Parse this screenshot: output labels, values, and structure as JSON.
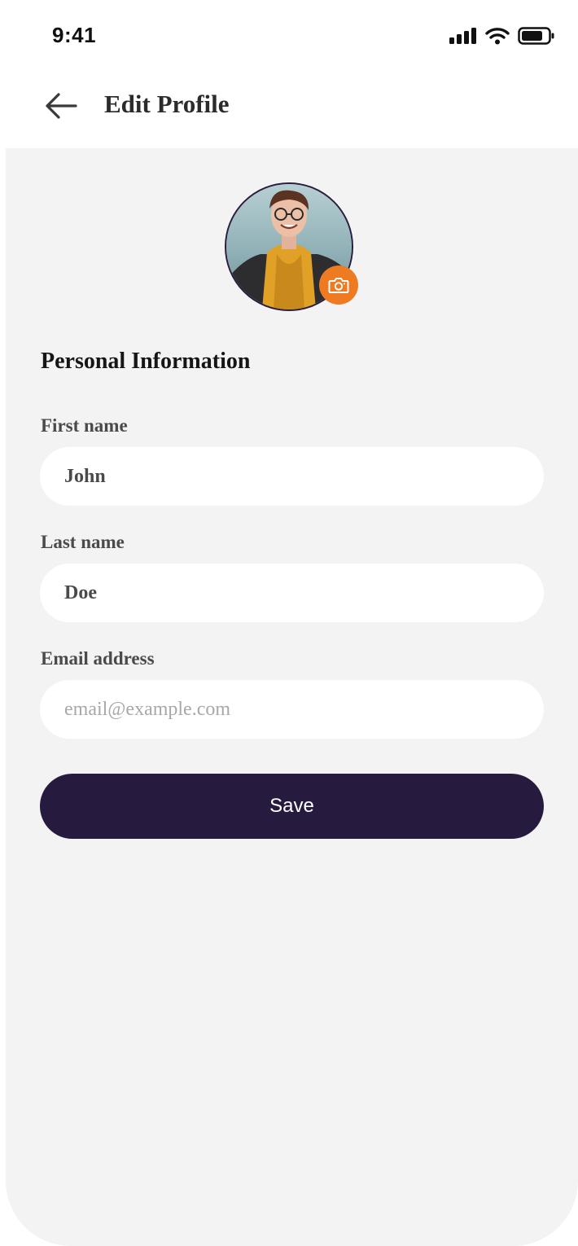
{
  "status_bar": {
    "time": "9:41",
    "icons": [
      "signal-icon",
      "wifi-icon",
      "battery-icon"
    ]
  },
  "header": {
    "back_icon": "arrow-left-icon",
    "title": "Edit Profile"
  },
  "profile": {
    "avatar": "avatar",
    "camera_icon": "camera-icon",
    "accent_color": "#ee7a22"
  },
  "form": {
    "section_title": "Personal Information",
    "first_name": {
      "label": "First name",
      "value": "John",
      "placeholder": ""
    },
    "last_name": {
      "label": "Last name",
      "value": "Doe",
      "placeholder": ""
    },
    "email": {
      "label": "Email address",
      "value": "",
      "placeholder": "email@example.com"
    },
    "save_label": "Save",
    "save_color": "#261a3f"
  }
}
